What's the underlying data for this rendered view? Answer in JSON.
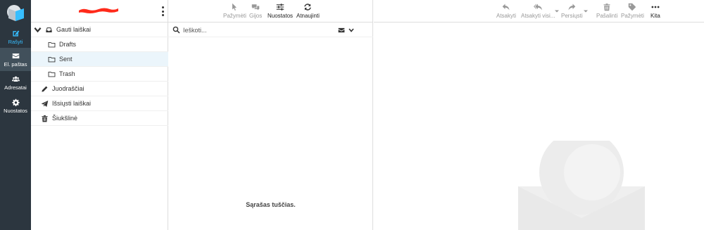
{
  "rail": {
    "items": [
      {
        "label": "Rašyti",
        "icon": "compose-icon"
      },
      {
        "label": "El. paštas",
        "icon": "envelope-icon"
      },
      {
        "label": "Adresatai",
        "icon": "contacts-icon"
      },
      {
        "label": "Nuostatos",
        "icon": "gear-icon"
      }
    ]
  },
  "folders": {
    "items": [
      {
        "label": "Gauti laiškai",
        "icon": "inbox-icon"
      },
      {
        "label": "Drafts",
        "icon": "folder-icon"
      },
      {
        "label": "Sent",
        "icon": "folder-icon"
      },
      {
        "label": "Trash",
        "icon": "folder-icon"
      },
      {
        "label": "Juodraščiai",
        "icon": "pencil-icon"
      },
      {
        "label": "Išsiųsti laiškai",
        "icon": "paper-plane-icon"
      },
      {
        "label": "Šiukšlinė",
        "icon": "trash-icon"
      }
    ]
  },
  "list_toolbar": {
    "select": "Pažymėti",
    "threads": "Gijos",
    "options": "Nuostatos",
    "refresh": "Atnaujinti"
  },
  "search": {
    "placeholder": "Ieškoti..."
  },
  "list": {
    "empty": "Sąrašas tuščias."
  },
  "reader_toolbar": {
    "reply": "Atsakyti",
    "reply_all": "Atsakyti visi...",
    "forward": "Persiųsti",
    "delete": "Pašalinti",
    "mark": "Pažymėti",
    "more": "Kita"
  },
  "colors": {
    "rail_bg": "#2c363f",
    "accent": "#37beff",
    "selected_folder_bg": "#ebf5fb",
    "redaction": "#ff2a1a"
  }
}
